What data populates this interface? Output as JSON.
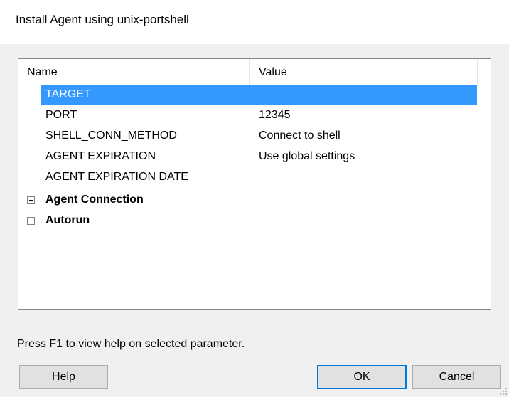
{
  "window": {
    "title": "Install Agent using unix-portshell"
  },
  "grid": {
    "columns": [
      "Name",
      "Value"
    ],
    "rows": [
      {
        "name": "TARGET",
        "value": "",
        "selected": true
      },
      {
        "name": "PORT",
        "value": "12345"
      },
      {
        "name": "SHELL_CONN_METHOD",
        "value": "Connect to shell"
      },
      {
        "name": "AGENT EXPIRATION",
        "value": "Use global settings"
      },
      {
        "name": "AGENT EXPIRATION DATE",
        "value": ""
      }
    ],
    "groups": [
      {
        "label": "Agent Connection",
        "expanded": false
      },
      {
        "label": "Autorun",
        "expanded": false
      }
    ]
  },
  "footer": {
    "help_text": "Press F1 to view help on selected parameter."
  },
  "buttons": {
    "help": "Help",
    "ok": "OK",
    "cancel": "Cancel"
  },
  "colors": {
    "selection": "#3399ff",
    "default_button_border": "#0078d7",
    "client_background": "#f0f0f0"
  }
}
